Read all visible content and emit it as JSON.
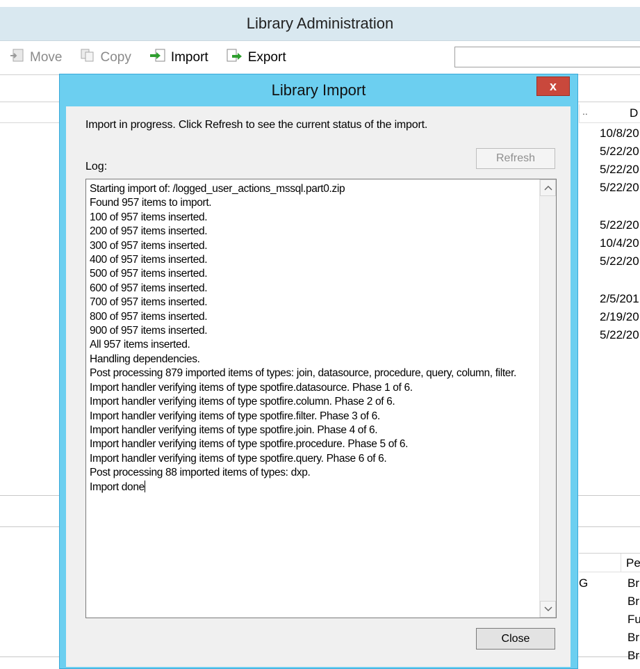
{
  "window": {
    "title": "Library Administration"
  },
  "toolbar": {
    "move_label": "Move",
    "copy_label": "Copy",
    "import_label": "Import",
    "export_label": "Export",
    "search_value": ""
  },
  "background_list": {
    "header_partial": "D",
    "header_dots": "..",
    "dates": [
      "10/8/20",
      "5/22/20",
      "5/22/20",
      "5/22/20",
      "5/22/20",
      "10/4/20",
      "5/22/20",
      "2/5/201",
      "2/19/20",
      "5/22/20"
    ]
  },
  "bottom_list": {
    "header_partial": "Pe",
    "group_letter": "G",
    "items": [
      "Br",
      "Br",
      "Fu",
      "Br",
      "Br"
    ]
  },
  "dialog": {
    "title": "Library Import",
    "close_x": "x",
    "instruction": "Import in progress. Click Refresh to see the current status of the import.",
    "log_label": "Log:",
    "refresh_label": "Refresh",
    "close_label": "Close",
    "log_lines": [
      "Starting import of: /logged_user_actions_mssql.part0.zip",
      "Found 957 items to import.",
      "100 of 957 items inserted.",
      "200 of 957 items inserted.",
      "300 of 957 items inserted.",
      "400 of 957 items inserted.",
      "500 of 957 items inserted.",
      "600 of 957 items inserted.",
      "700 of 957 items inserted.",
      "800 of 957 items inserted.",
      "900 of 957 items inserted.",
      "All 957 items inserted.",
      "Handling dependencies.",
      "Post processing 879 imported items of types: join, datasource, procedure, query, column, filter.",
      "Import handler verifying items of type spotfire.datasource. Phase 1 of 6.",
      "Import handler verifying items of type spotfire.column. Phase 2 of 6.",
      "Import handler verifying items of type spotfire.filter. Phase 3 of 6.",
      "Import handler verifying items of type spotfire.join. Phase 4 of 6.",
      "Import handler verifying items of type spotfire.procedure. Phase 5 of 6.",
      "Import handler verifying items of type spotfire.query. Phase 6 of 6.",
      "Post processing 88 imported items of types: dxp.",
      "Import done"
    ]
  }
}
